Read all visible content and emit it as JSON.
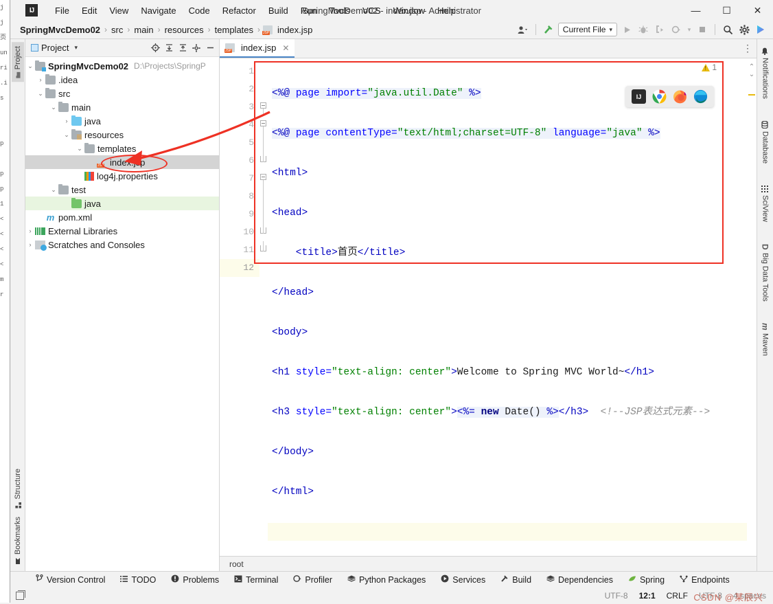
{
  "window": {
    "title": "SpringMvcDemo02 - index.jsp - Administrator",
    "minimize": "—",
    "maximize": "☐",
    "close": "✕",
    "logo": "IJ"
  },
  "menu": {
    "items": [
      {
        "label": "File"
      },
      {
        "label": "Edit"
      },
      {
        "label": "View"
      },
      {
        "label": "Navigate"
      },
      {
        "label": "Code"
      },
      {
        "label": "Refactor"
      },
      {
        "label": "Build"
      },
      {
        "label": "Run"
      },
      {
        "label": "Tools"
      },
      {
        "label": "VCS"
      },
      {
        "label": "Window"
      },
      {
        "label": "Help"
      }
    ]
  },
  "breadcrumb": {
    "sep": "›",
    "items": [
      {
        "label": "SpringMvcDemo02"
      },
      {
        "label": "src"
      },
      {
        "label": "main"
      },
      {
        "label": "resources"
      },
      {
        "label": "templates"
      },
      {
        "label": "index.jsp"
      }
    ]
  },
  "toolbar": {
    "profile_icon": "👤",
    "profile_caret": "▾",
    "hammer_icon": "build-hammer",
    "run_config": "Current File",
    "run_config_caret": "▾",
    "run_icon": "▶",
    "debug_icon": "debug-bug",
    "coverage_icon": "run-coverage",
    "profile_run_icon": "profiler-run",
    "profile_run_caret": "▾",
    "stop_icon": "■",
    "search_icon": "🔍",
    "settings_icon": "⚙",
    "updates_icon": "updates"
  },
  "left_strip": {
    "top": [
      {
        "label": "Project",
        "icon": "folder-icon",
        "active": true
      }
    ],
    "bottom": [
      {
        "label": "Structure",
        "icon": "structure-icon"
      },
      {
        "label": "Bookmarks",
        "icon": "bookmark-icon"
      }
    ]
  },
  "right_strip": {
    "items": [
      {
        "label": "Notifications",
        "icon": "bell-icon"
      },
      {
        "label": "Database",
        "icon": "database-icon"
      },
      {
        "label": "SciView",
        "icon": "sciview-icon"
      },
      {
        "label": "Big Data Tools",
        "icon": "bigdata-icon"
      },
      {
        "label": "Maven",
        "icon": "maven-icon"
      }
    ]
  },
  "project_panel": {
    "title": "Project",
    "caret": "▾",
    "icons": [
      "select-opened-file",
      "expand-all",
      "collapse-all",
      "settings-gear",
      "hide-panel"
    ],
    "tree": [
      {
        "indent": 0,
        "arrow": "⌄",
        "icon": "module-folder",
        "label": "SpringMvcDemo02",
        "bold": true,
        "hint": "D:\\Projects\\SpringP"
      },
      {
        "indent": 1,
        "arrow": "›",
        "icon": "folder",
        "label": ".idea",
        "bold": false,
        "hint": ""
      },
      {
        "indent": 1,
        "arrow": "⌄",
        "icon": "folder",
        "label": "src",
        "bold": false,
        "hint": ""
      },
      {
        "indent": 2,
        "arrow": "⌄",
        "icon": "folder",
        "label": "main",
        "bold": false,
        "hint": ""
      },
      {
        "indent": 3,
        "arrow": "›",
        "icon": "folder-blue",
        "label": "java",
        "bold": false,
        "hint": ""
      },
      {
        "indent": 3,
        "arrow": "⌄",
        "icon": "folder-resources",
        "label": "resources",
        "bold": false,
        "hint": ""
      },
      {
        "indent": 4,
        "arrow": "⌄",
        "icon": "folder",
        "label": "templates",
        "bold": false,
        "hint": ""
      },
      {
        "indent": 5,
        "arrow": "",
        "icon": "jsp-file",
        "label": "index.jsp",
        "bold": false,
        "hint": "",
        "selected": true
      },
      {
        "indent": 4,
        "arrow": "",
        "icon": "properties-file",
        "label": "log4j.properties",
        "bold": false,
        "hint": ""
      },
      {
        "indent": 2,
        "arrow": "⌄",
        "icon": "folder",
        "label": "test",
        "bold": false,
        "hint": ""
      },
      {
        "indent": 3,
        "arrow": "",
        "icon": "folder-green",
        "label": "java",
        "bold": false,
        "hint": "",
        "green": true
      },
      {
        "indent": 1,
        "arrow": "",
        "icon": "maven-pom",
        "label": "pom.xml",
        "bold": false,
        "hint": ""
      },
      {
        "indent": 0,
        "arrow": "›",
        "icon": "external-libraries",
        "label": "External Libraries",
        "bold": false,
        "hint": ""
      },
      {
        "indent": 0,
        "arrow": "›",
        "icon": "scratches",
        "label": "Scratches and Consoles",
        "bold": false,
        "hint": ""
      }
    ]
  },
  "editor": {
    "tab": {
      "label": "index.jsp",
      "icon": "jsp-file-icon",
      "close": "✕"
    },
    "more_icon": "⋮",
    "inspection": {
      "count": "1",
      "icon": "warning-triangle"
    },
    "nav_up": "⌃",
    "nav_down": "⌄",
    "breadcrumb_bottom": "root",
    "line_numbers": [
      "1",
      "2",
      "3",
      "4",
      "5",
      "6",
      "7",
      "8",
      "9",
      "10",
      "11",
      "12"
    ],
    "lines": [
      {
        "n": 1,
        "segments": [
          {
            "t": "<%@ ",
            "c": "k-dir"
          },
          {
            "t": "page ",
            "c": "k-attr"
          },
          {
            "t": "import=",
            "c": "k-attr"
          },
          {
            "t": "\"java.util.Date\"",
            "c": "k-str"
          },
          {
            "t": " %>",
            "c": "k-dir"
          }
        ]
      },
      {
        "n": 2,
        "segments": [
          {
            "t": "<%@ ",
            "c": "k-dir"
          },
          {
            "t": "page ",
            "c": "k-attr"
          },
          {
            "t": "contentType=",
            "c": "k-attr"
          },
          {
            "t": "\"text/html;charset=UTF-8\"",
            "c": "k-str"
          },
          {
            "t": " language=",
            "c": "k-attr"
          },
          {
            "t": "\"java\"",
            "c": "k-str"
          },
          {
            "t": " %>",
            "c": "k-dir"
          }
        ]
      },
      {
        "n": 3,
        "segments": [
          {
            "t": "<html>",
            "c": "k-tag"
          }
        ]
      },
      {
        "n": 4,
        "segments": [
          {
            "t": "<head>",
            "c": "k-tag"
          }
        ]
      },
      {
        "n": 5,
        "segments": [
          {
            "t": "    <title>",
            "c": "k-tag"
          },
          {
            "t": "首页",
            "c": "k-txt"
          },
          {
            "t": "</title>",
            "c": "k-tag"
          }
        ]
      },
      {
        "n": 6,
        "segments": [
          {
            "t": "</head>",
            "c": "k-tag"
          }
        ]
      },
      {
        "n": 7,
        "segments": [
          {
            "t": "<body>",
            "c": "k-tag"
          }
        ]
      },
      {
        "n": 8,
        "segments": [
          {
            "t": "<h1 ",
            "c": "k-tag"
          },
          {
            "t": "style=",
            "c": "k-attr"
          },
          {
            "t": "\"text-align: center\"",
            "c": "k-str"
          },
          {
            "t": ">",
            "c": "k-tag"
          },
          {
            "t": "Welcome to Spring MVC World~",
            "c": "k-txt"
          },
          {
            "t": "</h1>",
            "c": "k-tag"
          }
        ]
      },
      {
        "n": 9,
        "segments": [
          {
            "t": "<h3 ",
            "c": "k-tag"
          },
          {
            "t": "style=",
            "c": "k-attr"
          },
          {
            "t": "\"text-align: center\"",
            "c": "k-str"
          },
          {
            "t": ">",
            "c": "k-tag"
          },
          {
            "t": "<%= ",
            "c": "k-dir"
          },
          {
            "t": "new ",
            "c": "k-kw"
          },
          {
            "t": "Date() ",
            "c": "k-txt"
          },
          {
            "t": "%>",
            "c": "k-dir"
          },
          {
            "t": "</h3>",
            "c": "k-tag"
          },
          {
            "t": "  <!--JSP表达式元素-->",
            "c": "k-comment"
          }
        ]
      },
      {
        "n": 10,
        "segments": [
          {
            "t": "</body>",
            "c": "k-tag"
          }
        ]
      },
      {
        "n": 11,
        "segments": [
          {
            "t": "</html>",
            "c": "k-tag"
          }
        ]
      },
      {
        "n": 12,
        "segments": [
          {
            "t": "",
            "c": "k-txt"
          }
        ]
      }
    ]
  },
  "browser_popup": {
    "items": [
      {
        "name": "intellij",
        "label": "IJ",
        "color": "#2b2b2b"
      },
      {
        "name": "chrome",
        "label": "",
        "color": "#4285f4"
      },
      {
        "name": "firefox",
        "label": "",
        "color": "#ff7139"
      },
      {
        "name": "edge",
        "label": "",
        "color": "#0f8bd6"
      }
    ]
  },
  "bottom_tools": [
    {
      "label": "Version Control",
      "icon": "branch-icon"
    },
    {
      "label": "TODO",
      "icon": "list-icon"
    },
    {
      "label": "Problems",
      "icon": "error-icon"
    },
    {
      "label": "Terminal",
      "icon": "terminal-icon"
    },
    {
      "label": "Profiler",
      "icon": "profiler-icon"
    },
    {
      "label": "Python Packages",
      "icon": "packages-icon"
    },
    {
      "label": "Services",
      "icon": "services-icon"
    },
    {
      "label": "Build",
      "icon": "hammer-icon"
    },
    {
      "label": "Dependencies",
      "icon": "layers-icon"
    },
    {
      "label": "Spring",
      "icon": "spring-leaf-icon"
    },
    {
      "label": "Endpoints",
      "icon": "endpoints-icon"
    }
  ],
  "status_bar": {
    "layout_icon": "layout-icon",
    "encoding": "UTF-8",
    "caret_position": "12:1",
    "line_separator": "CRLF",
    "file_encoding": "UTF-8",
    "indent": "4 spaces",
    "watermark": "CSDN @某辰兴"
  },
  "annotation": {
    "arrow_color": "#ee3124",
    "highlight_box_color": "#ee3124",
    "circled_item": "index.jsp"
  },
  "colors": {
    "accent": "#4a86c8",
    "annotation_red": "#ee3124",
    "panel_bg": "#f2f2f2",
    "editor_bg": "#ffffff",
    "selection_gray": "#d4d4d4",
    "green_row": "#e8f5e0",
    "caret_line": "#fdfcea"
  }
}
